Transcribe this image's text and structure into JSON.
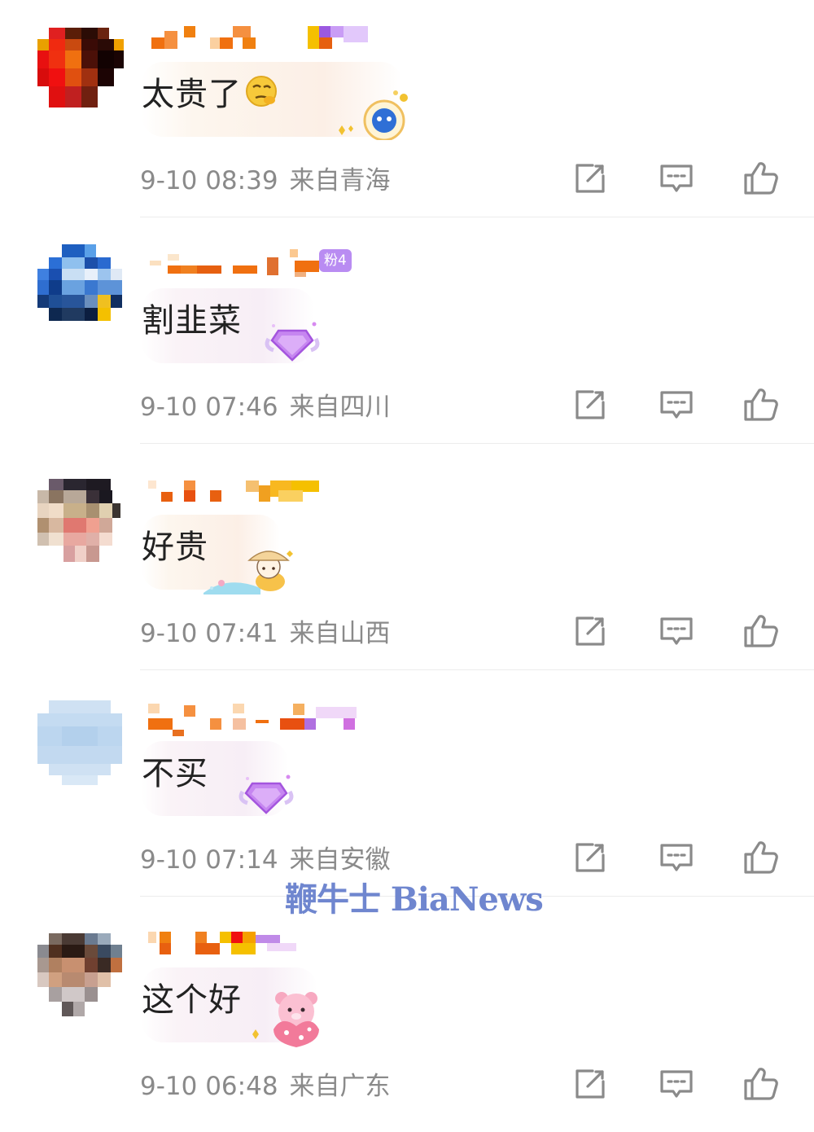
{
  "comments": [
    {
      "text": "太贵了",
      "time": "9-10 08:39",
      "location": "来自青海",
      "emoji": "thinking-face-emoji",
      "bubble": "warm"
    },
    {
      "text": "割韭菜",
      "time": "9-10 07:46",
      "location": "来自四川",
      "fan_badge": "粉4",
      "bubble": "pink"
    },
    {
      "text": "好贵",
      "time": "9-10 07:41",
      "location": "来自山西",
      "bubble": "warm"
    },
    {
      "text": "不买",
      "time": "9-10 07:14",
      "location": "来自安徽",
      "bubble": "pink"
    },
    {
      "text": "这个好",
      "time": "9-10 06:48",
      "location": "来自广东",
      "bubble": "pink"
    }
  ],
  "actions": {
    "share_icon": "share-icon",
    "reply_icon": "comment-icon",
    "like_icon": "thumbs-up-icon"
  },
  "watermark": "鞭牛士 BiaNews",
  "colors": {
    "meta_text": "#8a8a8a",
    "comment_text": "#222222",
    "fan_badge": "#b98cf2",
    "watermark": "#6f86cf"
  }
}
